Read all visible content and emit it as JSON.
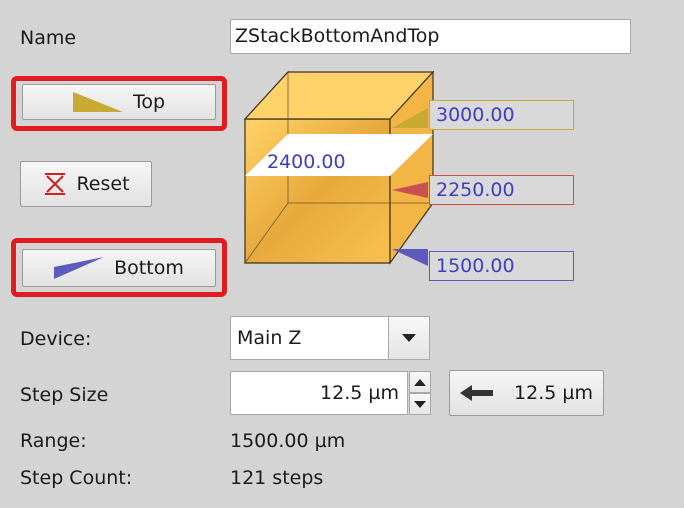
{
  "name": {
    "label": "Name",
    "value": "ZStackBottomAndTop"
  },
  "buttons": {
    "top": "Top",
    "reset": "Reset",
    "bottom": "Bottom"
  },
  "stack": {
    "top_value": "3000.00",
    "current_value": "2250.00",
    "bottom_value": "1500.00",
    "slice_value": "2400.00"
  },
  "device": {
    "label": "Device:",
    "value": "Main Z"
  },
  "step_size": {
    "label": "Step Size",
    "value": "12.5 µm",
    "set_button": "12.5 µm"
  },
  "range": {
    "label": "Range:",
    "value": "1500.00 µm"
  },
  "step_count": {
    "label": "Step Count:",
    "value": "121 steps"
  },
  "colors": {
    "top_marker": "#c8a933",
    "current_marker": "#c85050",
    "bottom_marker": "#5b5bbf",
    "highlight": "#e11b22",
    "cube": "#f7c252"
  },
  "icons": {
    "top": "top-triangle-icon",
    "reset": "reset-icon",
    "bottom": "bottom-triangle-icon",
    "dropdown": "chevron-down-icon",
    "arrow": "left-arrow-icon"
  }
}
